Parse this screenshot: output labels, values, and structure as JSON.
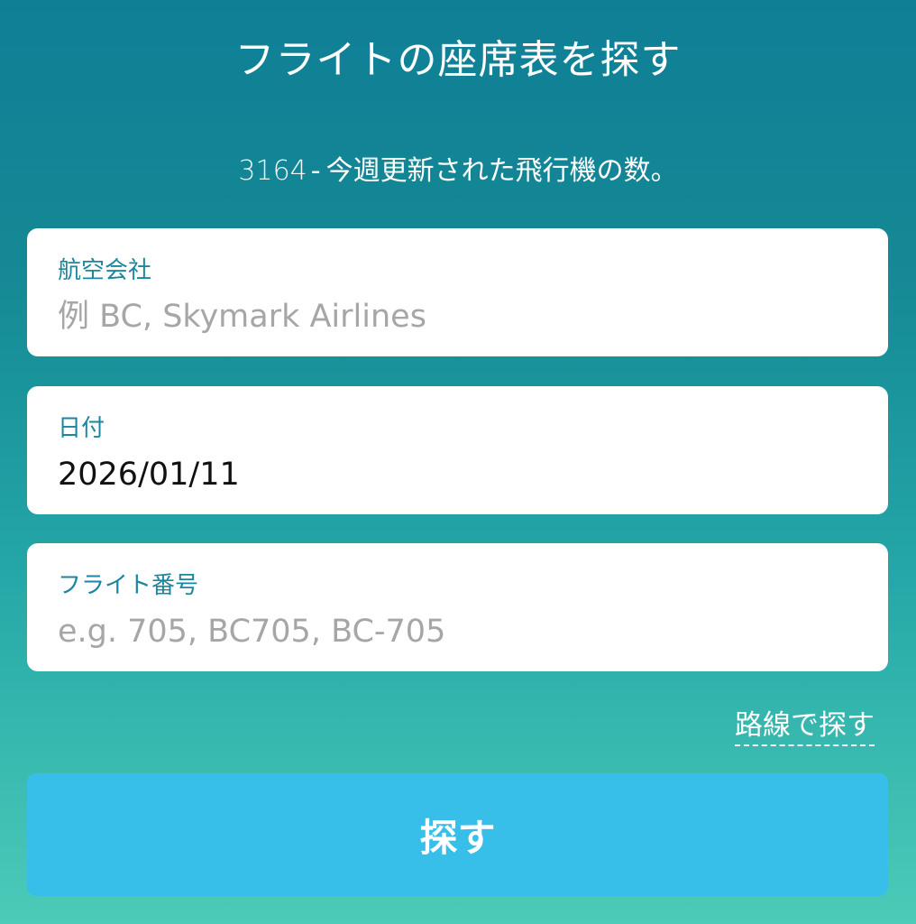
{
  "header": {
    "title": "フライトの座席表を探す",
    "count": "3164",
    "separator": "-",
    "count_text": "今週更新された飛行機の数。"
  },
  "form": {
    "airline": {
      "label": "航空会社",
      "value": "",
      "placeholder": "例 BC, Skymark Airlines"
    },
    "date": {
      "label": "日付",
      "value": "2026/01/11",
      "placeholder": ""
    },
    "flight_number": {
      "label": "フライト番号",
      "value": "",
      "placeholder": "e.g. 705, BC705, BC-705"
    }
  },
  "route_link": "路線で探す",
  "search_button": "探す",
  "colors": {
    "accent_label": "#1b86a0",
    "button": "#38bfe9",
    "gradient_top": "#0f7f96",
    "gradient_bottom": "#4ccbb8"
  }
}
